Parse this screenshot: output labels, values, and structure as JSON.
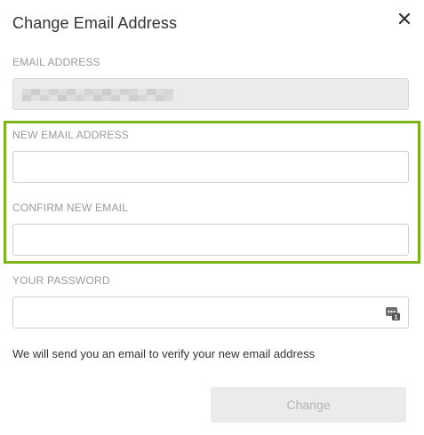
{
  "dialog": {
    "title": "Change Email Address",
    "close_icon": "close-icon"
  },
  "current_email": {
    "label": "EMAIL ADDRESS",
    "value_state": "obscured"
  },
  "new_email": {
    "label": "NEW EMAIL ADDRESS",
    "value": "",
    "placeholder": ""
  },
  "confirm_email": {
    "label": "CONFIRM NEW EMAIL",
    "value": "",
    "placeholder": ""
  },
  "password": {
    "label": "YOUR PASSWORD",
    "value": "",
    "placeholder": "",
    "icon": "password-manager-icon"
  },
  "info_text": "We will send you an email to verify your new email address",
  "submit": {
    "label": "Change",
    "state": "disabled"
  },
  "colors": {
    "highlight": "#7cb518",
    "label": "#9a9a9a",
    "button_bg": "#ebebeb",
    "button_text": "#b4b4b4"
  }
}
